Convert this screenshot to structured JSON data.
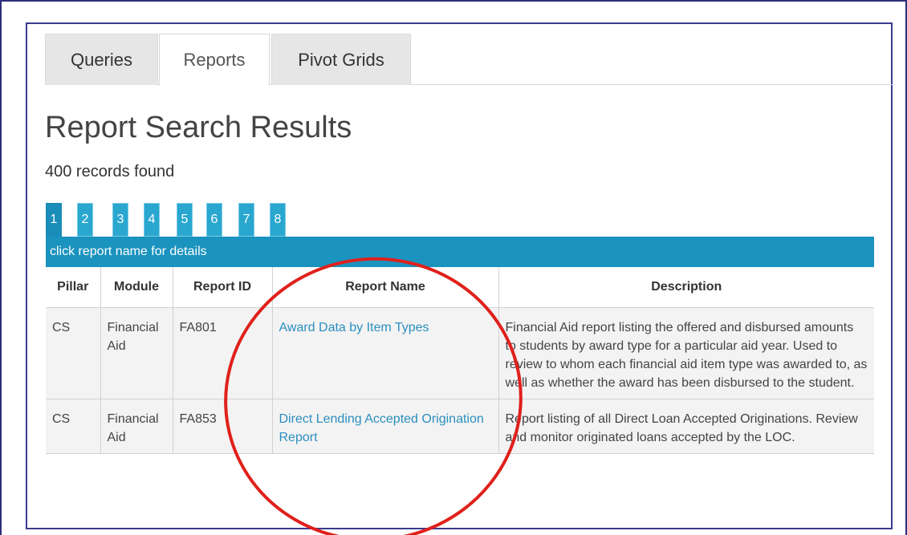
{
  "tabs": [
    {
      "label": "Queries",
      "active": false
    },
    {
      "label": "Reports",
      "active": true
    },
    {
      "label": "Pivot Grids",
      "active": false
    }
  ],
  "page_title": "Report Search Results",
  "records_found": "400 records found",
  "pagination": [
    "1",
    "2",
    "3",
    "4",
    "5",
    "6",
    "7",
    "8"
  ],
  "active_page": "1",
  "hint_band": "click report name for details",
  "table": {
    "headers": [
      "Pillar",
      "Module",
      "Report ID",
      "Report Name",
      "Description"
    ],
    "rows": [
      {
        "pillar": "CS",
        "module": "Financial Aid",
        "report_id": "FA801",
        "report_name": "Award Data by Item Types",
        "description": "Financial Aid report listing the offered and disbursed amounts to students by award type for a particular aid year. Used to review to whom each financial aid item type was awarded to, as well as whether the award has been disbursed to the student."
      },
      {
        "pillar": "CS",
        "module": "Financial Aid",
        "report_id": "FA853",
        "report_name": "Direct Lending Accepted Origination Report",
        "description": "Report listing of all Direct Loan Accepted Originations. Review and monitor originated loans accepted by the LOC."
      }
    ]
  },
  "colors": {
    "accent": "#1a93bf",
    "page_button": "#29a7cf",
    "link": "#2a8fbf",
    "annotation": "#e0201b",
    "frame": "#3b3b8f"
  }
}
